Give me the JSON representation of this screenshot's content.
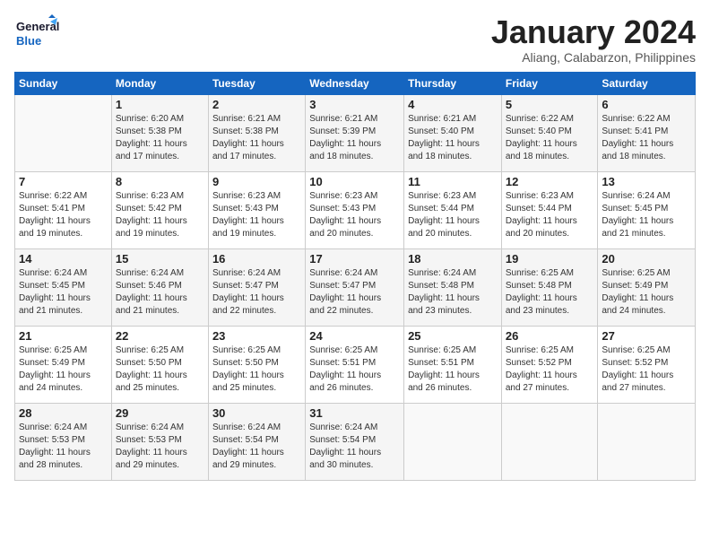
{
  "logo": {
    "line1": "General",
    "line2": "Blue"
  },
  "title": "January 2024",
  "subtitle": "Aliang, Calabarzon, Philippines",
  "weekdays": [
    "Sunday",
    "Monday",
    "Tuesday",
    "Wednesday",
    "Thursday",
    "Friday",
    "Saturday"
  ],
  "weeks": [
    [
      {
        "num": "",
        "info": ""
      },
      {
        "num": "1",
        "info": "Sunrise: 6:20 AM\nSunset: 5:38 PM\nDaylight: 11 hours\nand 17 minutes."
      },
      {
        "num": "2",
        "info": "Sunrise: 6:21 AM\nSunset: 5:38 PM\nDaylight: 11 hours\nand 17 minutes."
      },
      {
        "num": "3",
        "info": "Sunrise: 6:21 AM\nSunset: 5:39 PM\nDaylight: 11 hours\nand 18 minutes."
      },
      {
        "num": "4",
        "info": "Sunrise: 6:21 AM\nSunset: 5:40 PM\nDaylight: 11 hours\nand 18 minutes."
      },
      {
        "num": "5",
        "info": "Sunrise: 6:22 AM\nSunset: 5:40 PM\nDaylight: 11 hours\nand 18 minutes."
      },
      {
        "num": "6",
        "info": "Sunrise: 6:22 AM\nSunset: 5:41 PM\nDaylight: 11 hours\nand 18 minutes."
      }
    ],
    [
      {
        "num": "7",
        "info": "Sunrise: 6:22 AM\nSunset: 5:41 PM\nDaylight: 11 hours\nand 19 minutes."
      },
      {
        "num": "8",
        "info": "Sunrise: 6:23 AM\nSunset: 5:42 PM\nDaylight: 11 hours\nand 19 minutes."
      },
      {
        "num": "9",
        "info": "Sunrise: 6:23 AM\nSunset: 5:43 PM\nDaylight: 11 hours\nand 19 minutes."
      },
      {
        "num": "10",
        "info": "Sunrise: 6:23 AM\nSunset: 5:43 PM\nDaylight: 11 hours\nand 20 minutes."
      },
      {
        "num": "11",
        "info": "Sunrise: 6:23 AM\nSunset: 5:44 PM\nDaylight: 11 hours\nand 20 minutes."
      },
      {
        "num": "12",
        "info": "Sunrise: 6:23 AM\nSunset: 5:44 PM\nDaylight: 11 hours\nand 20 minutes."
      },
      {
        "num": "13",
        "info": "Sunrise: 6:24 AM\nSunset: 5:45 PM\nDaylight: 11 hours\nand 21 minutes."
      }
    ],
    [
      {
        "num": "14",
        "info": "Sunrise: 6:24 AM\nSunset: 5:45 PM\nDaylight: 11 hours\nand 21 minutes."
      },
      {
        "num": "15",
        "info": "Sunrise: 6:24 AM\nSunset: 5:46 PM\nDaylight: 11 hours\nand 21 minutes."
      },
      {
        "num": "16",
        "info": "Sunrise: 6:24 AM\nSunset: 5:47 PM\nDaylight: 11 hours\nand 22 minutes."
      },
      {
        "num": "17",
        "info": "Sunrise: 6:24 AM\nSunset: 5:47 PM\nDaylight: 11 hours\nand 22 minutes."
      },
      {
        "num": "18",
        "info": "Sunrise: 6:24 AM\nSunset: 5:48 PM\nDaylight: 11 hours\nand 23 minutes."
      },
      {
        "num": "19",
        "info": "Sunrise: 6:25 AM\nSunset: 5:48 PM\nDaylight: 11 hours\nand 23 minutes."
      },
      {
        "num": "20",
        "info": "Sunrise: 6:25 AM\nSunset: 5:49 PM\nDaylight: 11 hours\nand 24 minutes."
      }
    ],
    [
      {
        "num": "21",
        "info": "Sunrise: 6:25 AM\nSunset: 5:49 PM\nDaylight: 11 hours\nand 24 minutes."
      },
      {
        "num": "22",
        "info": "Sunrise: 6:25 AM\nSunset: 5:50 PM\nDaylight: 11 hours\nand 25 minutes."
      },
      {
        "num": "23",
        "info": "Sunrise: 6:25 AM\nSunset: 5:50 PM\nDaylight: 11 hours\nand 25 minutes."
      },
      {
        "num": "24",
        "info": "Sunrise: 6:25 AM\nSunset: 5:51 PM\nDaylight: 11 hours\nand 26 minutes."
      },
      {
        "num": "25",
        "info": "Sunrise: 6:25 AM\nSunset: 5:51 PM\nDaylight: 11 hours\nand 26 minutes."
      },
      {
        "num": "26",
        "info": "Sunrise: 6:25 AM\nSunset: 5:52 PM\nDaylight: 11 hours\nand 27 minutes."
      },
      {
        "num": "27",
        "info": "Sunrise: 6:25 AM\nSunset: 5:52 PM\nDaylight: 11 hours\nand 27 minutes."
      }
    ],
    [
      {
        "num": "28",
        "info": "Sunrise: 6:24 AM\nSunset: 5:53 PM\nDaylight: 11 hours\nand 28 minutes."
      },
      {
        "num": "29",
        "info": "Sunrise: 6:24 AM\nSunset: 5:53 PM\nDaylight: 11 hours\nand 29 minutes."
      },
      {
        "num": "30",
        "info": "Sunrise: 6:24 AM\nSunset: 5:54 PM\nDaylight: 11 hours\nand 29 minutes."
      },
      {
        "num": "31",
        "info": "Sunrise: 6:24 AM\nSunset: 5:54 PM\nDaylight: 11 hours\nand 30 minutes."
      },
      {
        "num": "",
        "info": ""
      },
      {
        "num": "",
        "info": ""
      },
      {
        "num": "",
        "info": ""
      }
    ]
  ]
}
